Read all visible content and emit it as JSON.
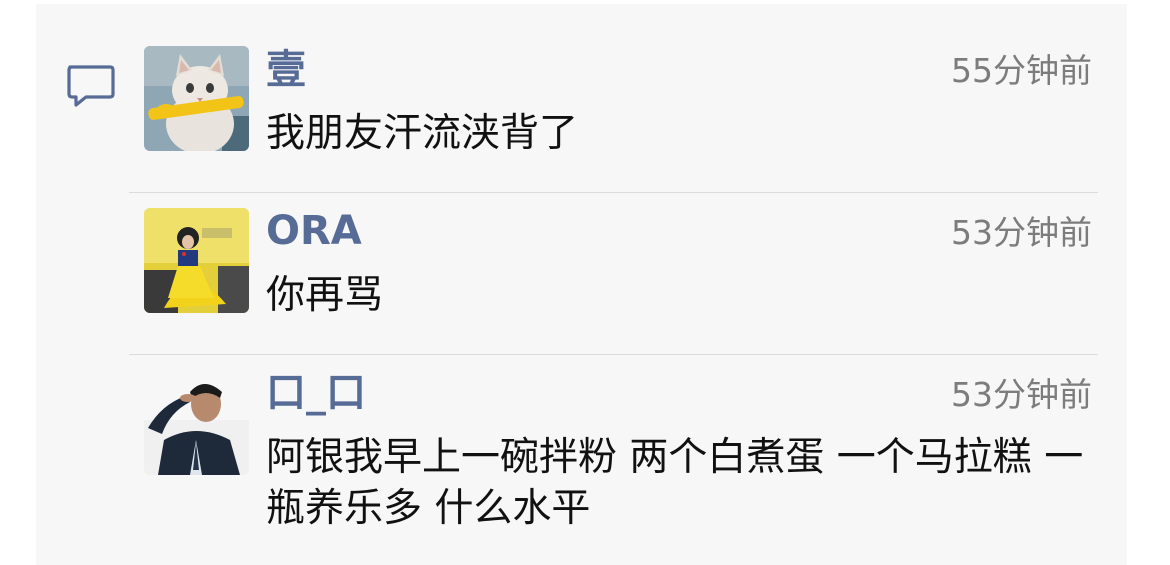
{
  "comments": [
    {
      "author": "壹",
      "time": "55分钟前",
      "text": "我朋友汗流浃背了",
      "avatar": "cat-avatar"
    },
    {
      "author": "ORA",
      "time": "53分钟前",
      "text": "你再骂",
      "avatar": "yellow-dress-avatar"
    },
    {
      "author": "口_口",
      "time": "53分钟前",
      "text": "阿银我早上一碗拌粉 两个白煮蛋 一个马拉糕 一瓶养乐多 什么水平",
      "avatar": "saluting-man-avatar"
    }
  ],
  "icons": {
    "comment": "comment-bubble-icon"
  },
  "colors": {
    "author": "#566b95",
    "time": "#7c7c7c",
    "panel": "#f7f7f7"
  }
}
